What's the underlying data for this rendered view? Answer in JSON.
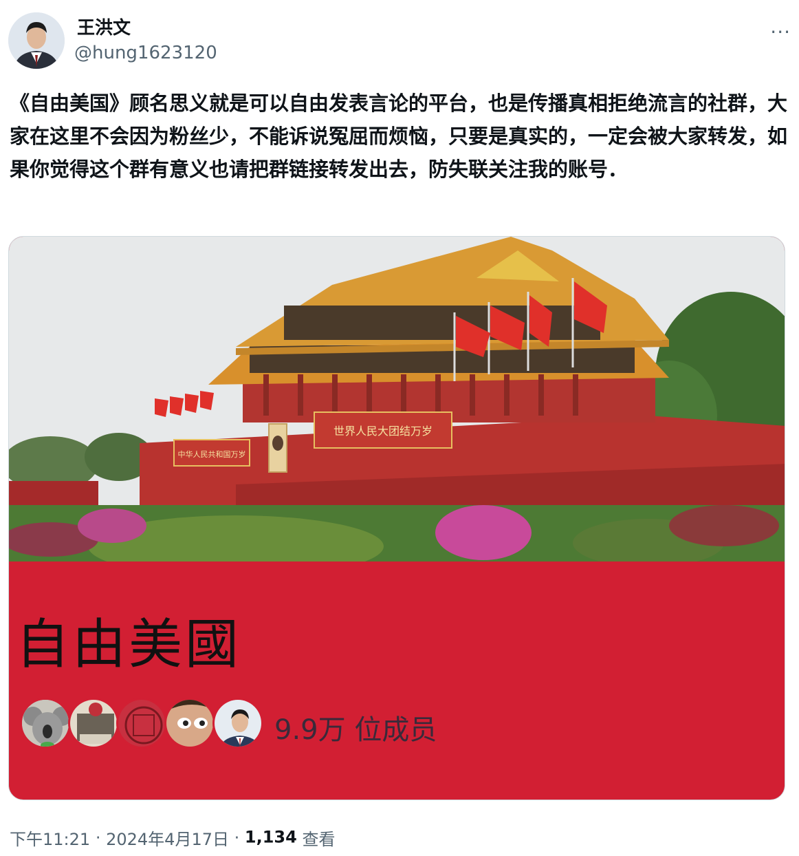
{
  "author": {
    "name": "王洪文",
    "handle": "@hung1623120"
  },
  "more_glyph": "···",
  "tweet": {
    "text": "《自由美国》顾名思义就是可以自由发表言论的平台，也是传播真相拒绝流言的社群，大家在这里不会因为粉丝少，不能诉说冤屈而烦恼，只要是真实的，一定会被大家转发，如果你觉得这个群有意义也请把群链接转发出去，防失联关注我的账号．"
  },
  "card": {
    "banner_left": "中华人民共和国万岁",
    "banner_right": "世界人民大团结万岁",
    "group_name": "自由美國",
    "member_count": "9.9万 位成员"
  },
  "footer": {
    "time": "下午11:21",
    "sep1": "·",
    "date": "2024年4月17日",
    "sep2": "·",
    "views": "1,134",
    "views_label": "查看"
  },
  "colors": {
    "card_red": "#d21f33",
    "secondary_text": "#536471"
  }
}
